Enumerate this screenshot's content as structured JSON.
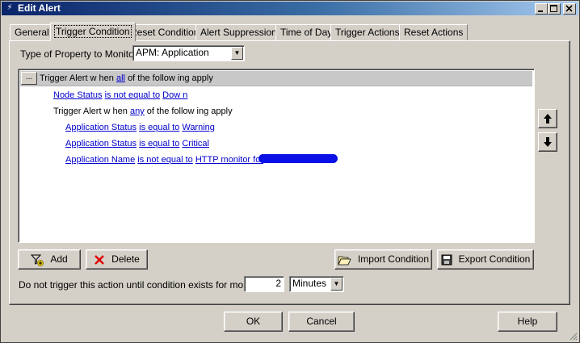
{
  "window": {
    "title": "Edit Alert",
    "controls": [
      "minimize",
      "maximize",
      "close"
    ]
  },
  "tabs": [
    {
      "label": "General",
      "active": false
    },
    {
      "label": "Trigger Condition",
      "active": true
    },
    {
      "label": "Reset Condition",
      "active": false
    },
    {
      "label": "Alert Suppression",
      "active": false
    },
    {
      "label": "Time of Day",
      "active": false
    },
    {
      "label": "Trigger Actions",
      "active": false
    },
    {
      "label": "Reset Actions",
      "active": false
    }
  ],
  "property": {
    "label": "Type of Property to Monitor:",
    "value": "APM: Application"
  },
  "tree": {
    "header": {
      "ellipsis": "...",
      "prefix": "Trigger Alert w hen",
      "quantifier": "all",
      "suffix": "of the follow ing apply"
    },
    "rows": [
      {
        "field": "Node Status",
        "op": "is not equal to",
        "value": "Dow n"
      },
      {
        "group_prefix": "Trigger Alert w hen",
        "group_quantifier": "any",
        "group_suffix": "of the follow ing apply"
      },
      {
        "field": "Application Status",
        "op": "is equal to",
        "value": "Warning"
      },
      {
        "field": "Application Status",
        "op": "is equal to",
        "value": "Critical"
      },
      {
        "field": "Application Name",
        "op": "is not equal to",
        "value": "HTTP monitor for"
      }
    ]
  },
  "buttons": {
    "add": "Add",
    "delete": "Delete",
    "import": "Import Condition",
    "export": "Export Condition",
    "ok": "OK",
    "cancel": "Cancel",
    "help": "Help"
  },
  "duration": {
    "label": "Do not trigger this action until condition exists for more than",
    "value": "2",
    "unit": "Minutes"
  },
  "colors": {
    "link": "#0000cc",
    "title_gradient_start": "#0a246a",
    "face": "#d4d0c8"
  }
}
